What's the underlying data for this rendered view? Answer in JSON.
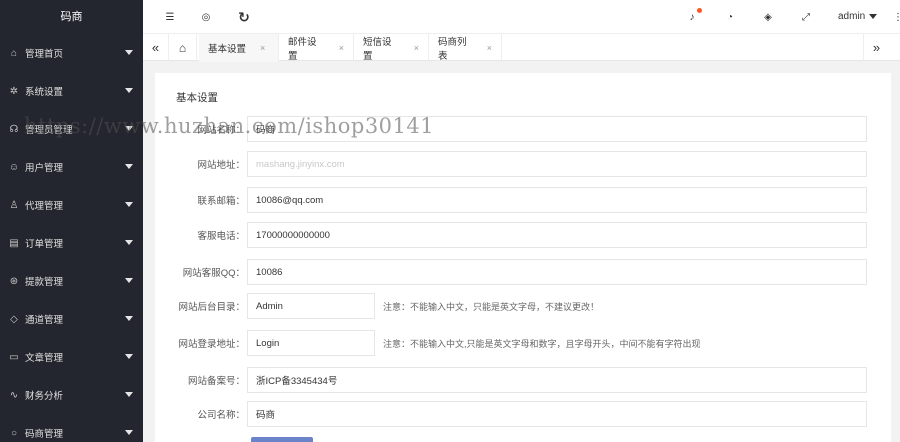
{
  "sidebar": {
    "logo": "码商",
    "items": [
      {
        "label": "管理首页",
        "icon": "home-icon",
        "glyph": "⌂"
      },
      {
        "label": "系统设置",
        "icon": "gear-icon",
        "glyph": "✲"
      },
      {
        "label": "管理员管理",
        "icon": "headset-icon",
        "glyph": "☊"
      },
      {
        "label": "用户管理",
        "icon": "user-icon",
        "glyph": "☺"
      },
      {
        "label": "代理管理",
        "icon": "agent-icon",
        "glyph": "♙"
      },
      {
        "label": "订单管理",
        "icon": "order-icon",
        "glyph": "▤"
      },
      {
        "label": "提款管理",
        "icon": "withdraw-icon",
        "glyph": "⊛"
      },
      {
        "label": "通道管理",
        "icon": "diamond-icon",
        "glyph": "◇"
      },
      {
        "label": "文章管理",
        "icon": "article-icon",
        "glyph": "▭"
      },
      {
        "label": "财务分析",
        "icon": "chart-icon",
        "glyph": "∿"
      },
      {
        "label": "码商管理",
        "icon": "circle-icon",
        "glyph": "○"
      }
    ]
  },
  "header": {
    "icons": {
      "menu": "☰",
      "globe": "◎",
      "refresh": "↻",
      "bell": "♪",
      "theme": "◔",
      "tag": "◈",
      "fullscreen": "⤢",
      "more": "⋮"
    },
    "user": "admin"
  },
  "tabs": {
    "prev": "«",
    "next": "»",
    "home": "⌂",
    "items": [
      "基本设置",
      "邮件设置",
      "短信设置",
      "码商列表"
    ],
    "close": "×"
  },
  "form": {
    "title": "基本设置",
    "rows": [
      {
        "label": "网站名称：",
        "value": "码商"
      },
      {
        "label": "网站地址：",
        "value": "mashang.jinyinx.com"
      },
      {
        "label": "联系邮箱：",
        "value": "10086@qq.com"
      },
      {
        "label": "客服电话：",
        "value": "17000000000000"
      },
      {
        "label": "网站客服QQ：",
        "value": "10086"
      },
      {
        "label": "网站后台目录：",
        "value": "Admin",
        "hint": "注意：不能输入中文，只能是英文字母，不建议更改！"
      },
      {
        "label": "网站登录地址：",
        "value": "Login",
        "hint": "注意：不能输入中文,只能是英文字母和数字，且字母开头，中间不能有字符出现"
      },
      {
        "label": "网站备案号：",
        "value": "浙ICP备3345434号"
      },
      {
        "label": "公司名称：",
        "value": "码商"
      }
    ]
  },
  "watermark": "https://www.huzhan.com/ishop30141"
}
